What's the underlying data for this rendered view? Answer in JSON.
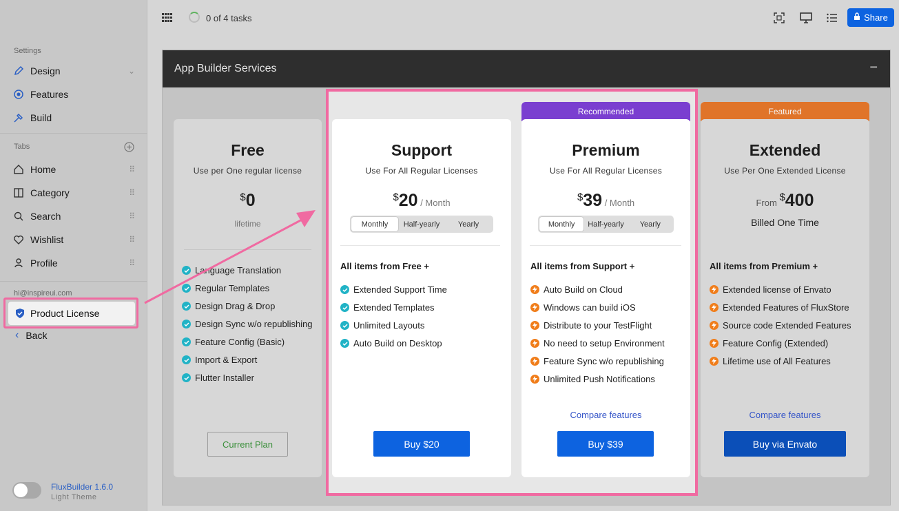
{
  "sidebar": {
    "settings_title": "Settings",
    "settings_items": [
      {
        "label": "Design",
        "icon": "pen-icon"
      },
      {
        "label": "Features",
        "icon": "target-icon"
      },
      {
        "label": "Build",
        "icon": "hammer-icon"
      }
    ],
    "tabs_title": "Tabs",
    "tab_items": [
      {
        "label": "Home",
        "icon": "home-icon"
      },
      {
        "label": "Category",
        "icon": "category-icon"
      },
      {
        "label": "Search",
        "icon": "search-icon"
      },
      {
        "label": "Wishlist",
        "icon": "heart-icon"
      },
      {
        "label": "Profile",
        "icon": "user-icon"
      }
    ],
    "email": "hi@inspireui.com",
    "product_license": "Product License",
    "back": "Back",
    "version": "FluxBuilder 1.6.0",
    "theme": "Light Theme"
  },
  "topbar": {
    "tasks": "0 of 4 tasks",
    "share": "Share"
  },
  "panel": {
    "title": "App Builder Services",
    "collapse": "−"
  },
  "plans": {
    "free": {
      "title": "Free",
      "subtitle": "Use per One regular license",
      "currency": "$",
      "amount": "0",
      "note": "lifetime",
      "features": [
        "Language Translation",
        "Regular Templates",
        "Design Drag & Drop",
        "Design Sync w/o republishing",
        "Feature Config (Basic)",
        "Import & Export",
        "Flutter Installer"
      ],
      "button": "Current Plan"
    },
    "support": {
      "title": "Support",
      "subtitle": "Use For All Regular Licenses",
      "currency": "$",
      "amount": "20",
      "period": " / Month",
      "segments": [
        "Monthly",
        "Half-yearly",
        "Yearly"
      ],
      "features_head": "All items from Free  +",
      "features": [
        "Extended Support Time",
        "Extended Templates",
        "Unlimited Layouts",
        "Auto Build on Desktop"
      ],
      "button": "Buy $20"
    },
    "premium": {
      "ribbon": "Recommended",
      "title": "Premium",
      "subtitle": "Use For All Regular Licenses",
      "currency": "$",
      "amount": "39",
      "period": " / Month",
      "segments": [
        "Monthly",
        "Half-yearly",
        "Yearly"
      ],
      "features_head": "All items from Support  +",
      "features": [
        "Auto Build on Cloud",
        "Windows can build iOS",
        "Distribute to your TestFlight",
        "No need to setup Environment",
        "Feature Sync w/o republishing",
        "Unlimited Push Notifications"
      ],
      "compare": "Compare features",
      "button": "Buy $39"
    },
    "extended": {
      "ribbon": "Featured",
      "title": "Extended",
      "subtitle": "Use Per One Extended License",
      "from": "From ",
      "currency": "$",
      "amount": "400",
      "note": "Billed One Time",
      "features_head": "All items from Premium +",
      "features": [
        "Extended license of Envato",
        "Extended Features of FluxStore",
        "Source code Extended Features",
        "Feature Config (Extended)",
        "Lifetime use of All Features"
      ],
      "compare": "Compare features",
      "button": "Buy via Envato"
    }
  },
  "colors": {
    "primary": "#0d63e0",
    "recommended": "#7a3fd0",
    "featured": "#e5670f",
    "highlight": "#f06aa1",
    "check": "#21b3c6",
    "bolt": "#f07d1a"
  }
}
